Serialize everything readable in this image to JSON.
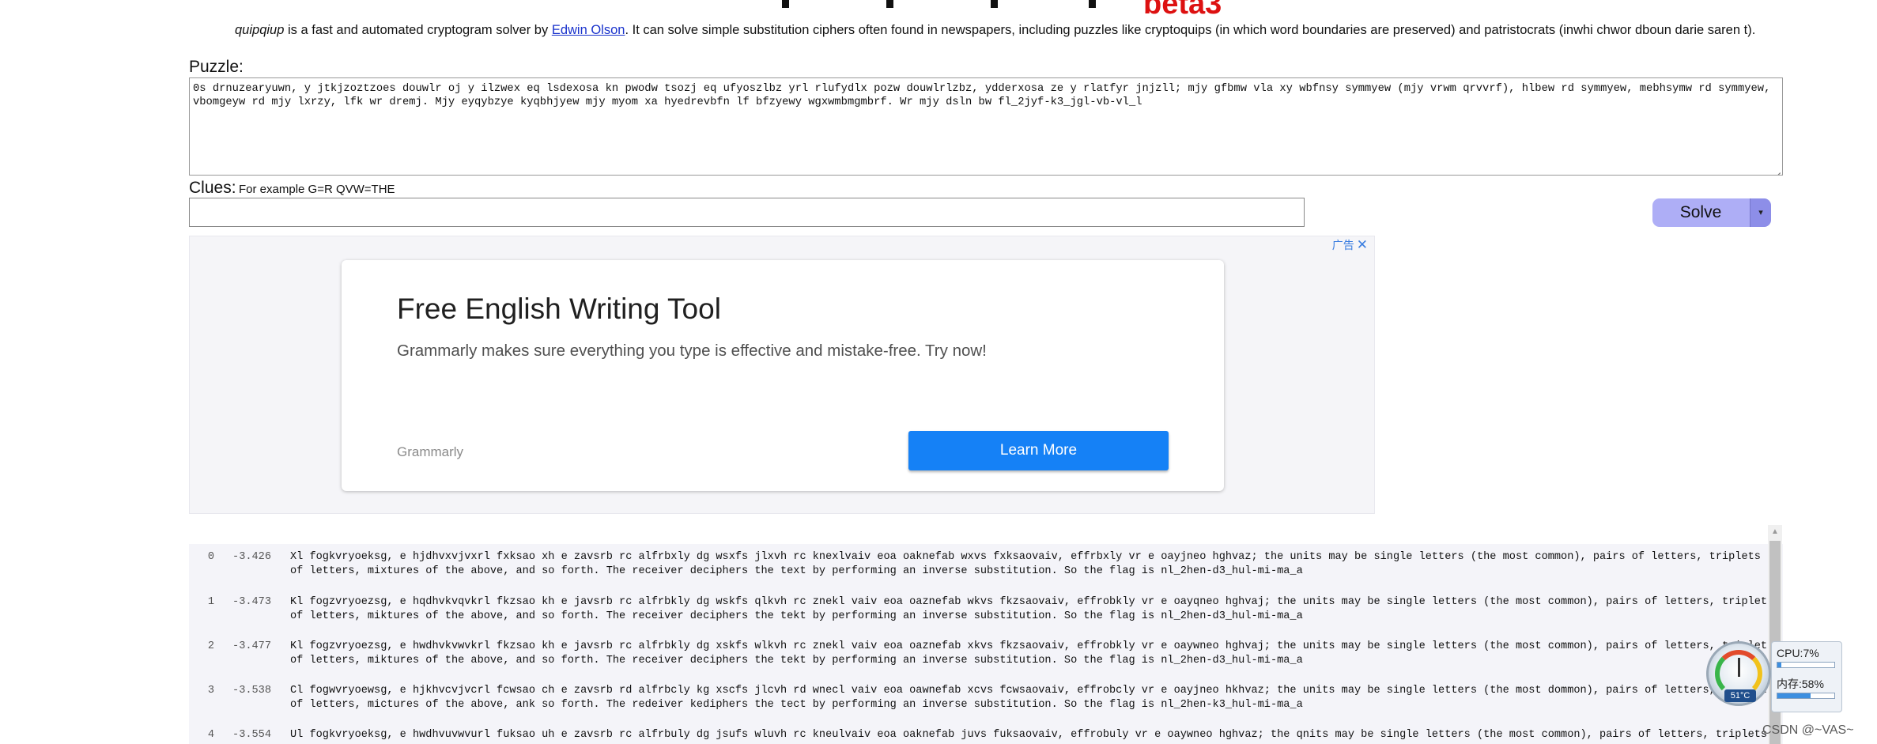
{
  "header": {
    "beta_label": "beta3",
    "intro": {
      "app_name": "quipqiup",
      "text_before_link": " is a fast and automated cryptogram solver by ",
      "author_link": "Edwin Olson",
      "text_after_link": ". It can solve simple substitution ciphers often found in newspapers, including puzzles like cryptoquips (in which word boundaries are preserved) and patristocrats (inwhi chwor dboun darie saren t)."
    }
  },
  "puzzle": {
    "label": "Puzzle:",
    "value": "0s drnuzearyuwn, y jtkjzoztzoes douwlr oj y ilzwex eq lsdexosa kn pwodw tsozj eq ufyoszlbz yrl rlufydlx pozw douwlrlzbz, ydderxosa ze y rlatfyr jnjzll; mjy gfbmw vla xy wbfnsy symmyew (mjy vrwm qrvvrf), hlbew rd symmyew, mebhsymw rd symmyew, vbomgeyw rd mjy lxrzy, lfk wr dremj. Mjy eyqybzye kyqbhjyew mjy myom xa hyedrevbfn lf bfzyewy wgxwmbmgmbrf. Wr mjy dsln bw fl_2jyf-k3_jgl-vb-vl_l"
  },
  "clues": {
    "label": "Clues:",
    "example": "For example G=R QVW=THE",
    "value": ""
  },
  "solve": {
    "label": "Solve",
    "caret": "▾"
  },
  "ad": {
    "badge": "广告",
    "close": "✕",
    "title": "Free English Writing Tool",
    "description": "Grammarly makes sure everything you type is effective and mistake-free. Try now!",
    "brand": "Grammarly",
    "cta": "Learn More"
  },
  "results": [
    {
      "index": "0",
      "score": "-3.426",
      "line1": "Xl fogkvryoeksg, e hjdhvxvjvxrl fxksao xh e zavsrb rc alfrbxly dg wsxfs jlxvh rc knexlvaiv eoa oaknefab wxvs fxksaovaiv, effrbxly vr e oayjneo hghvaz; the units may be single letters (the most common), pairs of letters, triplets",
      "line2": "of letters, mixtures of the above, and so forth. The receiver deciphers the text by performing an inverse substitution. So the flag is nl_2hen-d3_hul-mi-ma_a"
    },
    {
      "index": "1",
      "score": "-3.473",
      "line1": "Kl fogzvryoezsg, e hqdhvkvqvkrl fkzsao kh e javsrb rc alfrbkly dg wskfs qlkvh rc znekl vaiv eoa oaznefab wkvs fkzsaovaiv, effrobkly vr e oayqneo hghvaj; the units may be single letters (the most common), pairs of letters, triplets",
      "line2": "of letters, miktures of the above, and so forth. The receiver deciphers the tekt by performing an inverse substitution. So the flag is nl_2hen-d3_hul-mi-ma_a"
    },
    {
      "index": "2",
      "score": "-3.477",
      "line1": "Kl fogzvryoezsg, e hwdhvkvwvkrl fkzsao kh e javsrb rc alfrbkly dg xskfs wlkvh rc znekl vaiv eoa oaznefab xkvs fkzsaovaiv, effrobkly vr e oaywneo hghvaj; the units may be single letters (the most common), pairs of letters, triplets",
      "line2": "of letters, miktures of the above, and so forth. The receiver deciphers the tekt by performing an inverse substitution. So the flag is nl_2hen-d3_hul-mi-ma_a"
    },
    {
      "index": "3",
      "score": "-3.538",
      "line1": "Cl fogwvryoewsg, e hjkhvcvjvcrl fcwsao ch e zavsrb rd alfrbcly kg xscfs jlcvh rd wnecl vaiv eoa oawnefab xcvs fcwsaovaiv, effrobcly vr e oayjneo hkhvaz; the units may be single letters (the most dommon), pairs of letters, triplets",
      "line2": "of letters, mictures of the above, ank so forth. The redeiver kediphers the tect by performing an inverse substitution. So the flag is nl_2hen-k3_hul-mi-ma_a"
    },
    {
      "index": "4",
      "score": "-3.554",
      "line1": "Ul fogkvryoeksg, e hwdhvuvwvurl fuksao uh e zavsrb rc alfrbuly dg jsufs wluvh rc kneulvaiv eoa oaknefab juvs fuksaovaiv, effrobuly vr e oaywneo hghvaz; the qnits may be single letters (the most common), pairs of letters, triplets",
      "line2": ""
    }
  ],
  "monitor": {
    "cpu_label": "CPU:7%",
    "cpu_fraction": 0.07,
    "mem_label": "内存:58%",
    "mem_fraction": 0.58,
    "temp_label": "51°C"
  },
  "watermark": "CSDN @~VAS~",
  "colors": {
    "beta": "#dd1111",
    "link": "#1a33cc",
    "solve_button": "#aeaef6",
    "ad_cta": "#1581f6"
  }
}
